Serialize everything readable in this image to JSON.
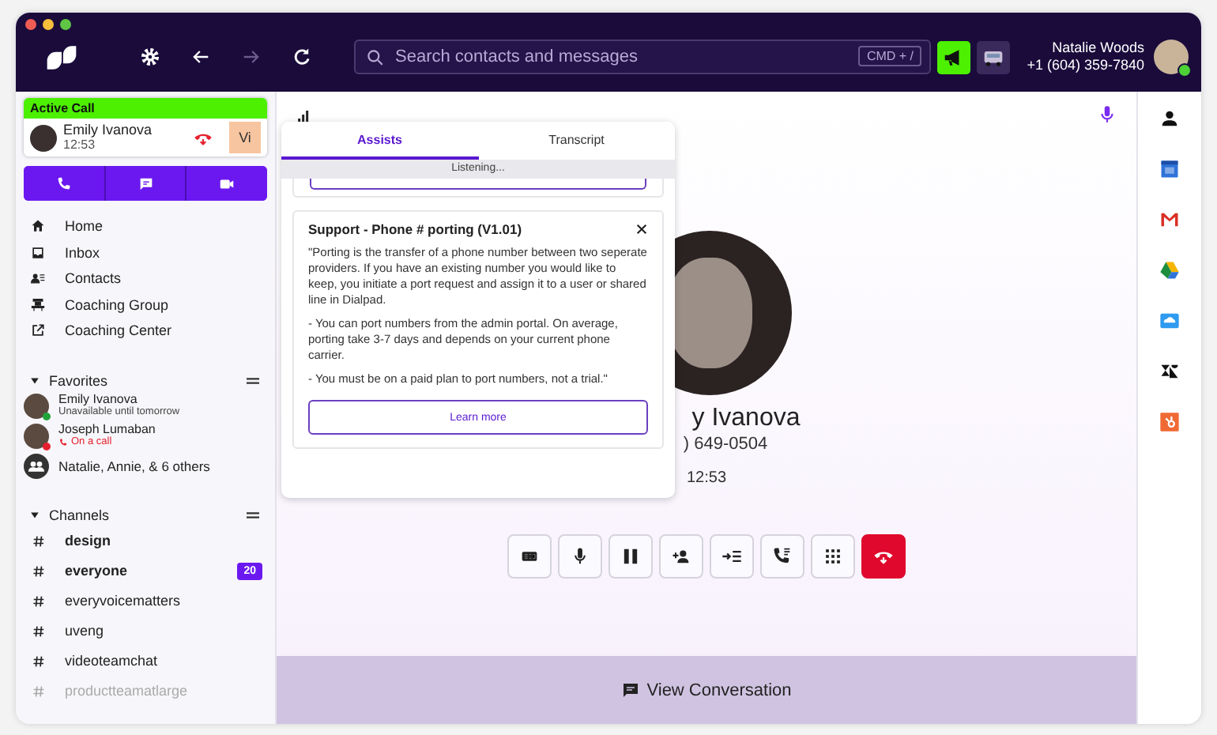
{
  "top_bar": {
    "search": {
      "placeholder": "Search contacts and messages"
    },
    "shortcut": "CMD + /",
    "user": {
      "name": "Natalie Woods",
      "phone": "+1 (604) 359-7840"
    }
  },
  "sidebar": {
    "active_call": {
      "label": "Active Call",
      "name": "Emily Ivanova",
      "time": "12:53",
      "initials": "Vi"
    },
    "nav": [
      {
        "kind": "home",
        "label": "Home"
      },
      {
        "kind": "inbox",
        "label": "Inbox"
      },
      {
        "kind": "contacts",
        "label": "Contacts"
      },
      {
        "kind": "group",
        "label": "Coaching Group"
      },
      {
        "kind": "external",
        "label": "Coaching Center"
      }
    ],
    "favorites": {
      "title": "Favorites",
      "items": [
        {
          "kind": "person",
          "name": "Emily Ivanova",
          "status": "Unavailable until tomorrow",
          "color": "#22a33a",
          "on_call": false
        },
        {
          "kind": "person",
          "name": "Joseph Lumaban",
          "status": "On a call",
          "color": "#e5202e",
          "on_call": true
        },
        {
          "kind": "group",
          "name": "Natalie, Annie, & 6 others"
        }
      ]
    },
    "channels": {
      "title": "Channels",
      "items": [
        {
          "name": "design",
          "unread": true,
          "muted": false
        },
        {
          "name": "everyone",
          "unread": true,
          "muted": false,
          "badge": "20"
        },
        {
          "name": "everyvoicematters",
          "unread": false,
          "muted": false
        },
        {
          "name": "uveng",
          "unread": false,
          "muted": false
        },
        {
          "name": "videoteamchat",
          "unread": false,
          "muted": false
        },
        {
          "name": "productteamatlarge",
          "unread": false,
          "muted": true
        }
      ]
    }
  },
  "call": {
    "name": "y Ivanova",
    "phone": ") 649-0504",
    "time": "12:53",
    "controls": [
      {
        "kind": "rec"
      },
      {
        "kind": "mic"
      },
      {
        "kind": "hold"
      },
      {
        "kind": "add"
      },
      {
        "kind": "transfer"
      },
      {
        "kind": "forward"
      },
      {
        "kind": "keypad"
      },
      {
        "kind": "hangup"
      }
    ],
    "view_conversation": "View Conversation"
  },
  "assist": {
    "tabs": [
      {
        "label": "Assists",
        "selected": true
      },
      {
        "label": "Transcript",
        "selected": false
      }
    ],
    "status": "Listening...",
    "card": {
      "title": "Support - Phone # porting (V1.01)",
      "paragraphs": [
        "\"Porting is the transfer of a phone number between two seperate providers. If you have an existing number you would like to keep, you initiate a port request and assign it to a user or shared line in Dialpad.",
        "- You can port numbers from the admin portal. On average, porting take 3-7 days and depends on your current phone carrier.",
        "- You must be on a paid plan to port numbers, not a trial.\""
      ],
      "button": "Learn more"
    }
  }
}
